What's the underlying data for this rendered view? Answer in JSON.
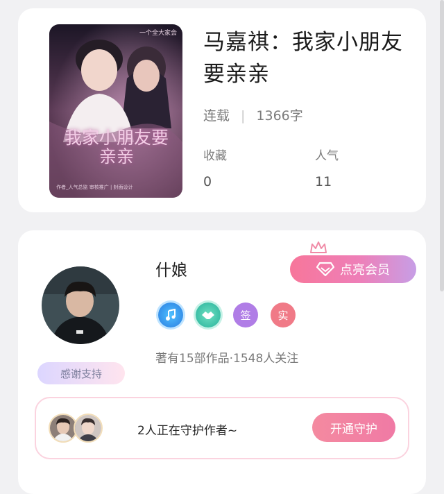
{
  "book": {
    "title": "马嘉祺：我家小朋友要亲亲",
    "status": "连载",
    "word_count": "1366字",
    "favorites_label": "收藏",
    "favorites_value": "0",
    "popularity_label": "人气",
    "popularity_value": "11",
    "cover": {
      "title_art": "我家小朋友要亲亲",
      "top_text": "一个全大家会",
      "bottom_text": "作者_人气总监  审核推广 | 封面设计"
    }
  },
  "author": {
    "name": "什娘",
    "member_button": "点亮会员",
    "badges": [
      {
        "icon": "music-badge-icon",
        "text": ""
      },
      {
        "icon": "handshake-badge-icon",
        "text": ""
      },
      {
        "icon": "sign-badge-icon",
        "text": "签"
      },
      {
        "icon": "real-badge-icon",
        "text": "实"
      }
    ],
    "works_info": "著有15部作品·1548人关注",
    "thanks_label": "感谢支持"
  },
  "guard": {
    "text": "2人正在守护作者~",
    "button": "开通守护"
  },
  "colors": {
    "member_gradient_start": "#f7769a",
    "member_gradient_end": "#c79ee6",
    "guard_button": "#f07aa5",
    "page_bg": "#f1f1f3"
  }
}
